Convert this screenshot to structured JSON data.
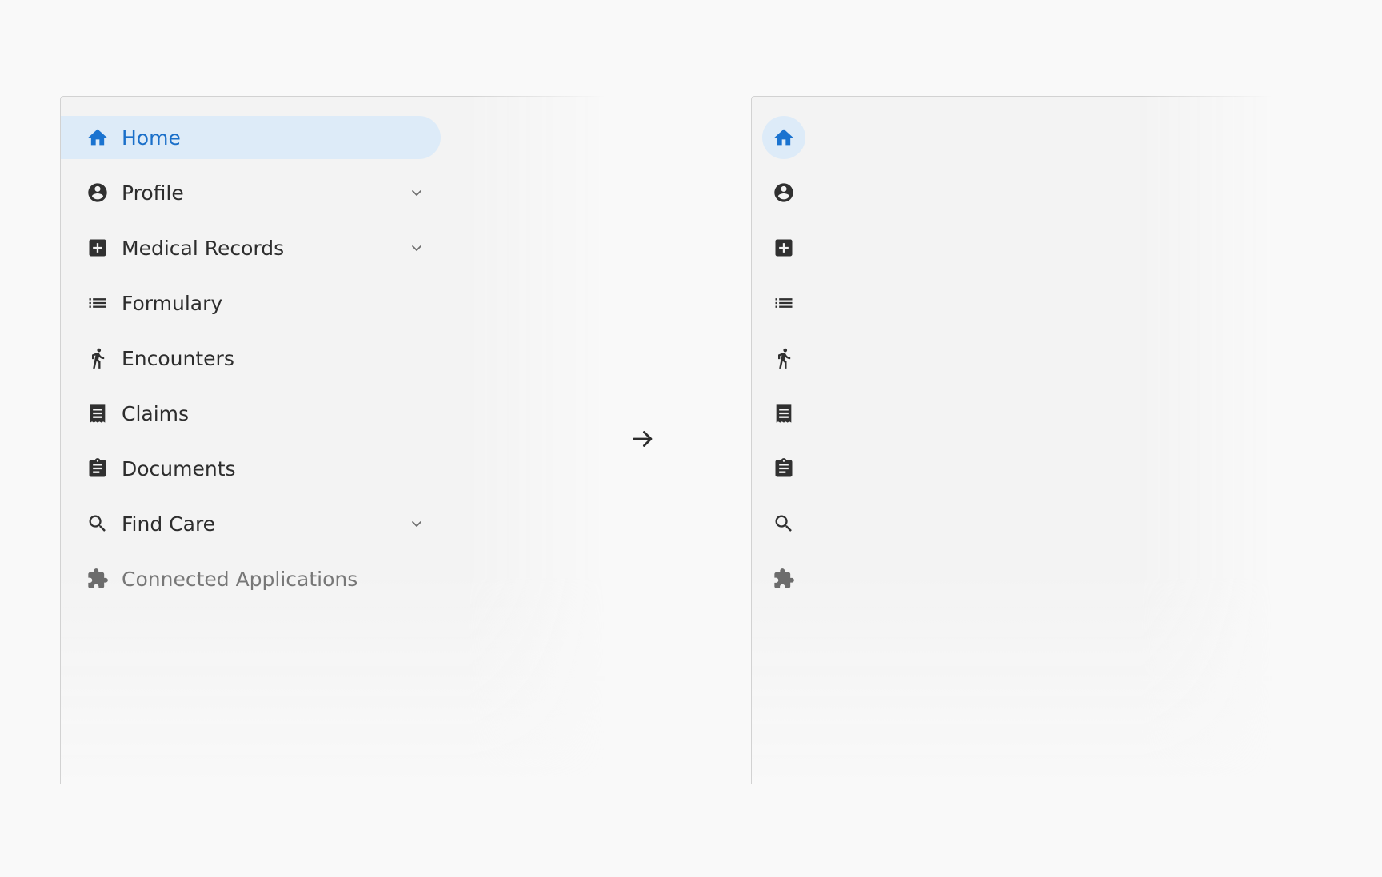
{
  "expanded_nav": {
    "items": [
      {
        "label": "Home",
        "icon": "home-icon",
        "active": true
      },
      {
        "label": "Profile",
        "icon": "account-circle-icon",
        "expandable": true
      },
      {
        "label": "Medical Records",
        "icon": "medical-plus-icon",
        "expandable": true
      },
      {
        "label": "Formulary",
        "icon": "list-icon"
      },
      {
        "label": "Encounters",
        "icon": "walking-person-icon"
      },
      {
        "label": "Claims",
        "icon": "receipt-icon"
      },
      {
        "label": "Documents",
        "icon": "clipboard-icon"
      },
      {
        "label": "Find Care",
        "icon": "search-icon",
        "expandable": true
      },
      {
        "label": "Connected Applications",
        "icon": "puzzle-icon",
        "muted": true
      }
    ]
  },
  "collapsed_nav": {
    "items": [
      {
        "icon": "home-icon",
        "active": true
      },
      {
        "icon": "account-circle-icon"
      },
      {
        "icon": "medical-plus-icon"
      },
      {
        "icon": "list-icon"
      },
      {
        "icon": "walking-person-icon"
      },
      {
        "icon": "receipt-icon"
      },
      {
        "icon": "clipboard-icon"
      },
      {
        "icon": "search-icon"
      },
      {
        "icon": "puzzle-icon",
        "muted": true
      }
    ]
  },
  "transition_icon": "arrow-right-icon",
  "colors": {
    "accent": "#1a73d0",
    "active_background": "#ddebf8",
    "text": "#2d2d2d",
    "muted_text": "#777777",
    "panel_background": "#f3f3f3",
    "page_background": "#f9f9f9"
  }
}
